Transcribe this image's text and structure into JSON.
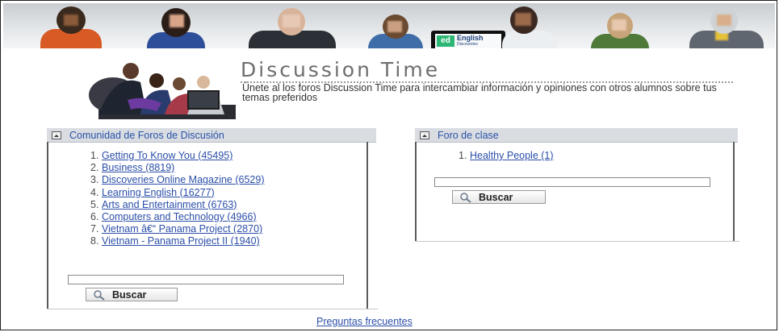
{
  "banner": {
    "badge_logo": "ed",
    "badge_title": "English",
    "badge_sub": "Discoveries"
  },
  "header": {
    "title": "Discussion Time",
    "subtitle": "Únete al los foros Discussion Time para intercambiar información y opiniones con otros alumnos sobre tus temas preferidos"
  },
  "community": {
    "title": "Comunidad de Foros de Discusión",
    "items": [
      {
        "num": "1.",
        "label": "Getting To Know You (45495)"
      },
      {
        "num": "2.",
        "label": "Business (8819)"
      },
      {
        "num": "3.",
        "label": "Discoveries Online Magazine (6529)"
      },
      {
        "num": "4.",
        "label": "Learning English (16277)"
      },
      {
        "num": "5.",
        "label": "Arts and Entertainment (6763)"
      },
      {
        "num": "6.",
        "label": "Computers and Technology (4966)"
      },
      {
        "num": "7.",
        "label": "Vietnam â€“ Panama Project (2870)"
      },
      {
        "num": "8.",
        "label": "Vietnam - Panama Project II (1940)"
      }
    ],
    "search_value": "",
    "search_label": "Buscar"
  },
  "class_forum": {
    "title": "Foro de clase",
    "items": [
      {
        "num": "1.",
        "label": "Healthy People (1)"
      }
    ],
    "search_value": "",
    "search_label": "Buscar"
  },
  "footer": {
    "faq_label": "Preguntas frecuentes"
  },
  "colors": {
    "link": "#2a4ea8",
    "panel_header": "#d9dde2",
    "badge_green": "#2bb673"
  },
  "icons": {
    "collapse": "collapse-icon",
    "search": "magnifier-icon"
  }
}
